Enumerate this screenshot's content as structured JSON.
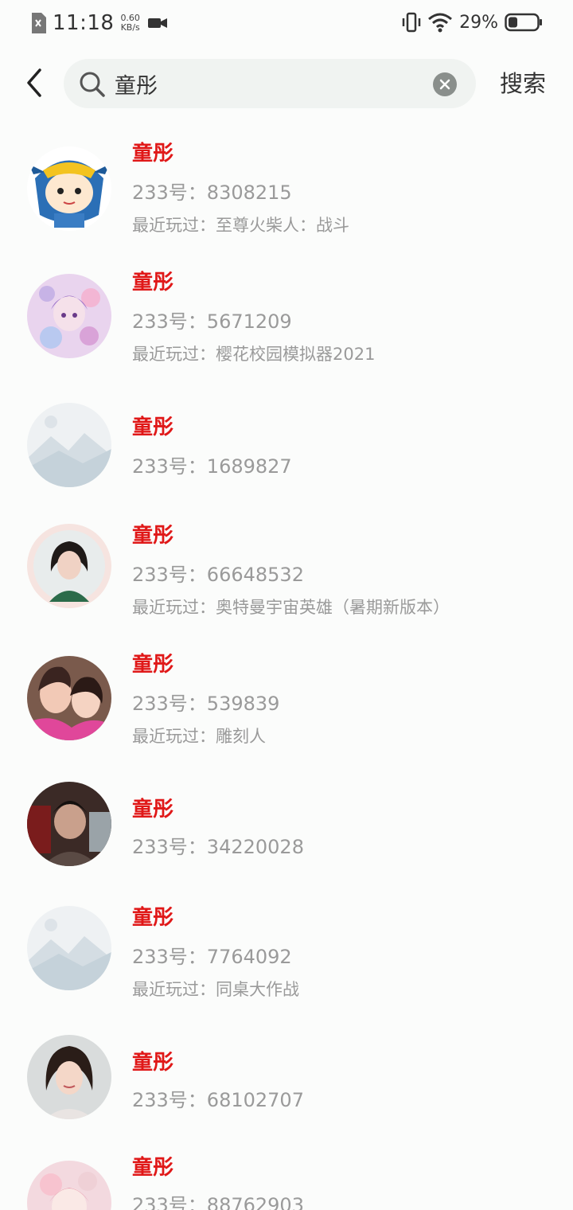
{
  "status_bar": {
    "time": "11:18",
    "net_speed_value": "0.60",
    "net_speed_unit": "KB/s",
    "battery": "29%"
  },
  "search": {
    "query": "童彤",
    "search_label": "搜索"
  },
  "colors": {
    "accent_name": "#e01818",
    "meta_text": "#9a9a9a",
    "search_bg": "#f0f3f1"
  },
  "results": [
    {
      "name": "童彤",
      "id_text": "233号：8308215",
      "recent": "最近玩过：至尊火柴人：战斗",
      "avatar": "cartoon-avatar"
    },
    {
      "name": "童彤",
      "id_text": "233号：5671209",
      "recent": "最近玩过：樱花校园模拟器2021",
      "avatar": "anime-avatar"
    },
    {
      "name": "童彤",
      "id_text": "233号：1689827",
      "recent": "",
      "avatar": "default-avatar"
    },
    {
      "name": "童彤",
      "id_text": "233号：66648532",
      "recent": "最近玩过：奥特曼宇宙英雄（暑期新版本）",
      "avatar": "photo-avatar"
    },
    {
      "name": "童彤",
      "id_text": "233号：539839",
      "recent": "最近玩过：雕刻人",
      "avatar": "photo-avatar"
    },
    {
      "name": "童彤",
      "id_text": "233号：34220028",
      "recent": "",
      "avatar": "photo-avatar"
    },
    {
      "name": "童彤",
      "id_text": "233号：7764092",
      "recent": "最近玩过：同桌大作战",
      "avatar": "default-avatar"
    },
    {
      "name": "童彤",
      "id_text": "233号：68102707",
      "recent": "",
      "avatar": "photo-avatar"
    },
    {
      "name": "童彤",
      "id_text": "233号：88762903",
      "recent": "",
      "avatar": "anime-avatar"
    }
  ]
}
